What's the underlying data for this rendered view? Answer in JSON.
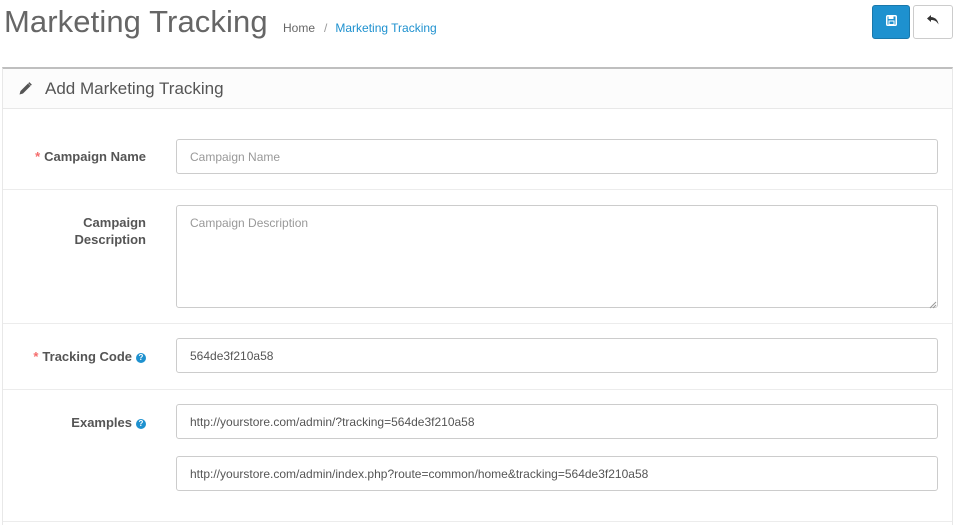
{
  "header": {
    "title": "Marketing Tracking",
    "breadcrumb": [
      {
        "label": "Home"
      },
      {
        "label": "Marketing Tracking"
      }
    ],
    "save_icon": "save-icon",
    "back_icon": "reply-icon"
  },
  "panel": {
    "icon": "pencil-icon",
    "title": "Add Marketing Tracking"
  },
  "form": {
    "campaign_name": {
      "label": "Campaign Name",
      "required": "*",
      "value": "",
      "placeholder": "Campaign Name"
    },
    "campaign_description": {
      "label_line1": "Campaign",
      "label_line2": "Description",
      "value": "",
      "placeholder": "Campaign Description"
    },
    "tracking_code": {
      "label": "Tracking Code",
      "required": "*",
      "help": "?",
      "value": "564de3f210a58"
    },
    "examples": {
      "label": "Examples",
      "help": "?",
      "values": [
        "http://yourstore.com/admin/?tracking=564de3f210a58",
        "http://yourstore.com/admin/index.php?route=common/home&tracking=564de3f210a58"
      ]
    }
  },
  "colors": {
    "primary": "#1e91cf",
    "required": "#f56b6b",
    "text": "#666666"
  }
}
